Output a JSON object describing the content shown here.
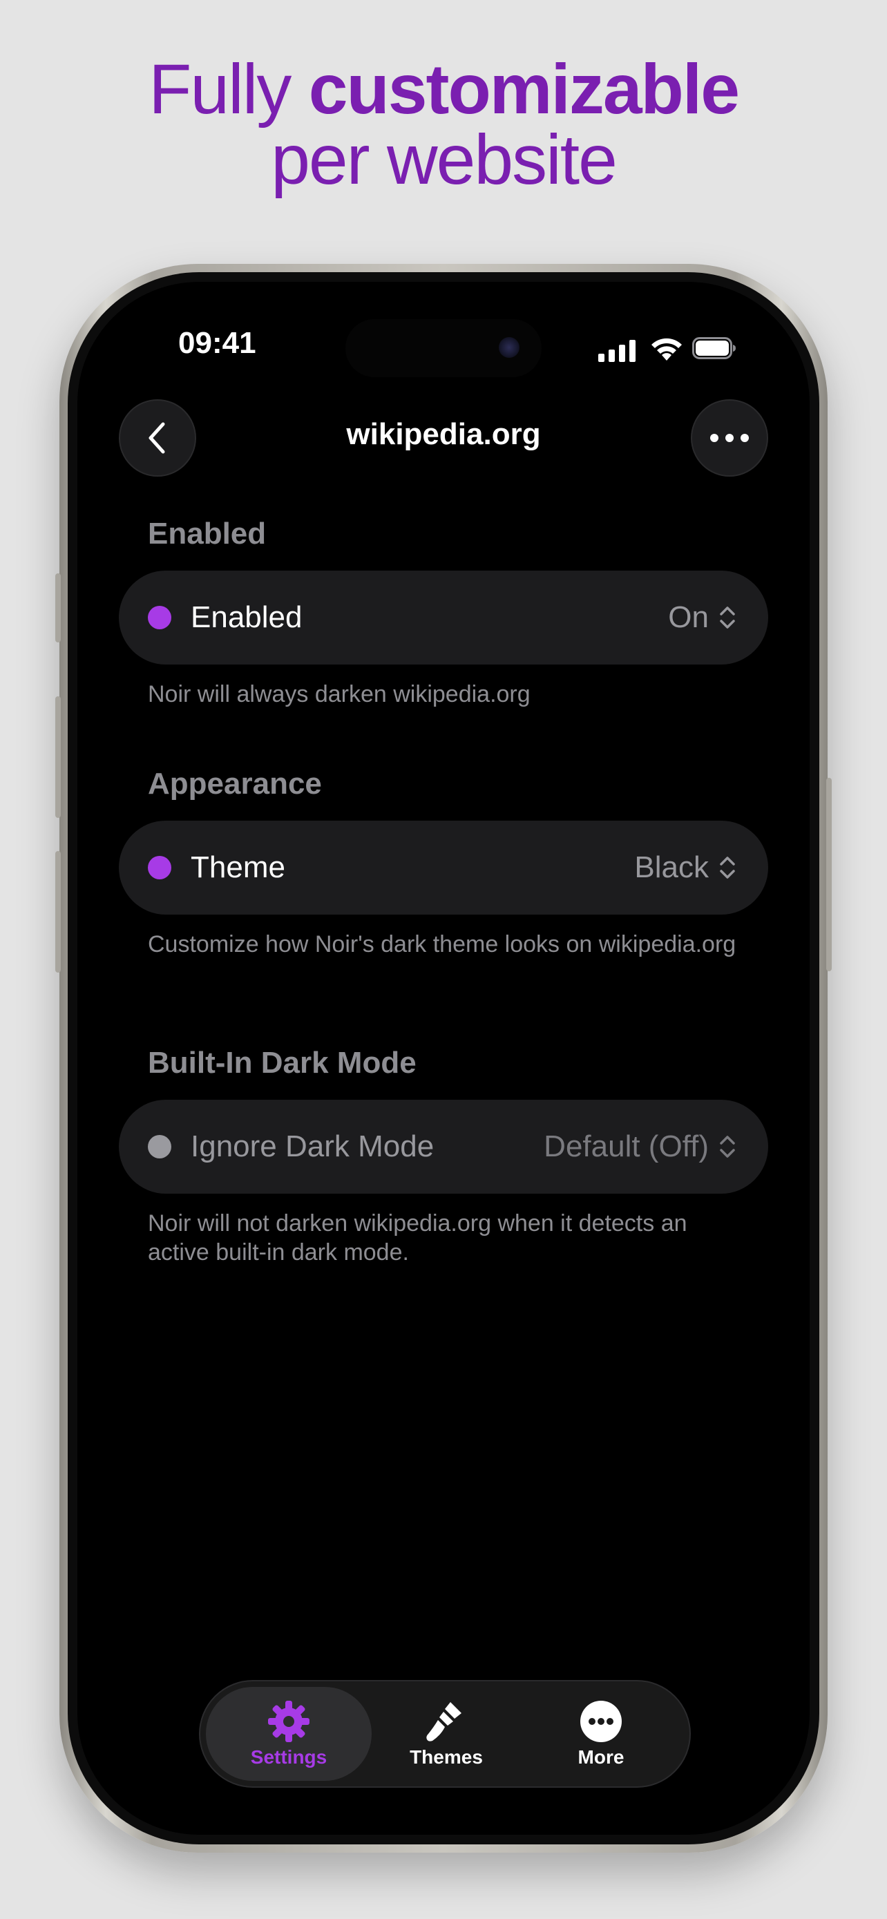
{
  "headline": {
    "line1_prefix": "Fully ",
    "line1_bold": "customizable",
    "line2": "per website"
  },
  "status_bar": {
    "time": "09:41"
  },
  "nav": {
    "title": "wikipedia.org",
    "back_icon": "chevron-left-icon",
    "more_icon": "ellipsis-icon"
  },
  "sections": [
    {
      "title": "Enabled",
      "row_label": "Enabled",
      "row_value": "On",
      "footnote": "Noir will always darken wikipedia.org",
      "dot_color": "#a73be6"
    },
    {
      "title": "Appearance",
      "row_label": "Theme",
      "row_value": "Black",
      "footnote": "Customize how Noir's dark theme looks on wikipedia.org",
      "dot_color": "#a73be6"
    },
    {
      "title": "Built-In Dark Mode",
      "row_label": "Ignore Dark Mode",
      "row_value": "Default (Off)",
      "footnote": "Noir will not darken wikipedia.org when it detects an active built-in dark mode.",
      "dot_color": "#9a9a9f"
    }
  ],
  "tabbar": {
    "items": [
      {
        "label": "Settings",
        "icon": "gear-icon",
        "active": true
      },
      {
        "label": "Themes",
        "icon": "paintbrush-icon",
        "active": false
      },
      {
        "label": "More",
        "icon": "ellipsis-circle-icon",
        "active": false
      }
    ]
  },
  "colors": {
    "accent": "#a73be6",
    "headline": "#7a1fb0",
    "background": "#e4e4e4",
    "screen": "#000000",
    "row_bg": "#1c1c1e"
  }
}
